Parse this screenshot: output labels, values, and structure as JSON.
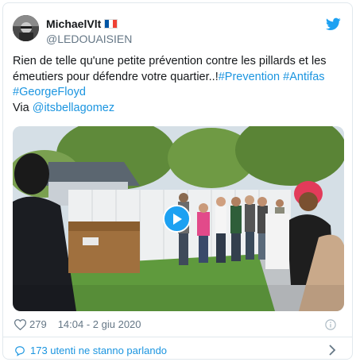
{
  "user": {
    "name": "MichaelVlt",
    "handle": "@LEDOUAISIEN"
  },
  "tweet": {
    "text_main": "Rien de telle qu'une petite prévention contre les pillards et les émeutiers pour défendre votre quartier..!",
    "hashtag_1": "#Prevention",
    "hashtag_2": "#Antifas",
    "hashtag_3": "#GeorgeFloyd",
    "via_label": "Via",
    "via_user": "@itsbellagomez"
  },
  "meta": {
    "likes": "279",
    "timestamp": "14:04 - 2 giu 2020"
  },
  "footer": {
    "conversation_label": "173 utenti ne stanno parlando"
  },
  "colors": {
    "link": "#1b95e0",
    "play_button": "#1da1f2",
    "brand": "#1da1f2",
    "secondary_text": "#657786"
  },
  "icons": [
    "twitter-bird-icon",
    "play-icon",
    "heart-icon",
    "info-icon",
    "speech-bubble-icon",
    "chevron-right-icon",
    "france-flag-icon"
  ]
}
